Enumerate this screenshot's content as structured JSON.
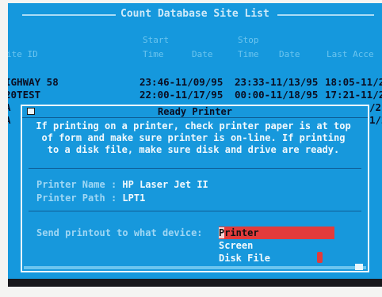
{
  "screen": {
    "title": "Count Database Site List",
    "columns": [
      {
        "text": "ite ID"
      },
      {
        "text": "Start"
      },
      {
        "text": "Time"
      },
      {
        "text": "Date"
      },
      {
        "text": "Stop"
      },
      {
        "text": "Time"
      },
      {
        "text": "Date"
      },
      {
        "text": "Last Acce"
      }
    ],
    "rows": [
      {
        "site": "IGHWAY 58",
        "start": "23:46-11/09/95",
        "stop": "23:33-11/13/95",
        "last": "18:05-11/2"
      },
      {
        "site": "20TEST",
        "start": "22:00-11/17/95",
        "stop": "00:00-11/18/95",
        "last": "17:21-11/2"
      }
    ],
    "side_edges": [
      {
        "left": "A",
        "right": "/2"
      },
      {
        "left": "A",
        "right": "1/2"
      }
    ]
  },
  "dialog": {
    "title": "Ready Printer",
    "message": [
      "If printing on a printer, check printer paper is at top",
      "of form and make sure printer is on-line. If printing",
      "to a disk file, make sure disk and drive are ready."
    ],
    "printer_name_label": "Printer Name",
    "printer_name_value": "HP Laser Jet II",
    "printer_path_label": "Printer Path",
    "printer_path_value": "LPT1",
    "separator": ":",
    "send_label": "Send printout to what device:",
    "options": [
      {
        "hotkey": "P",
        "rest": "rinter",
        "selected": true
      },
      {
        "hotkey": "S",
        "rest": "creen",
        "selected": false
      },
      {
        "hotkey": "D",
        "rest": "isk File",
        "selected": false
      }
    ]
  },
  "colors": {
    "screen_bg": "#1598dd",
    "highlight": "#e23b3b",
    "text_light": "#f1f9fd",
    "text_dark": "#0b0e22"
  }
}
